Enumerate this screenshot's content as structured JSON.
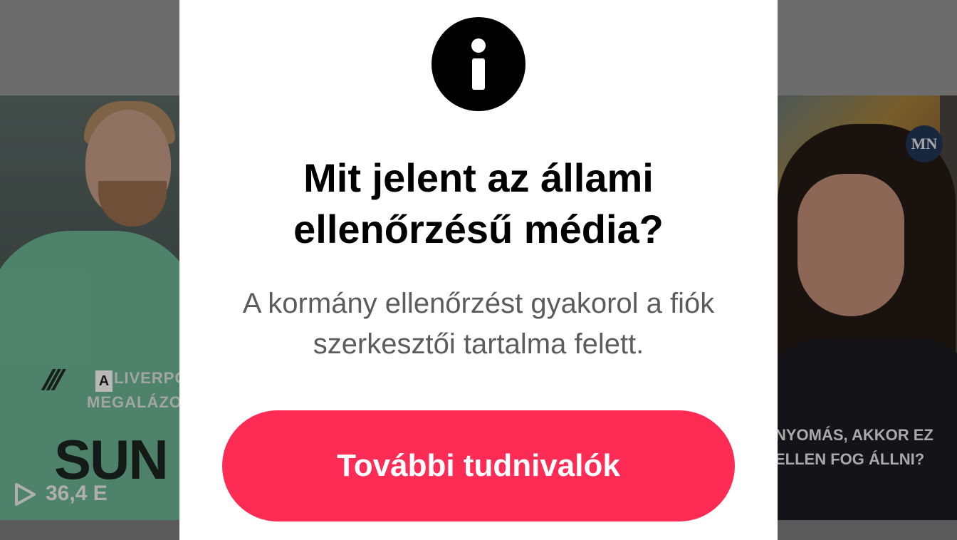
{
  "left_video": {
    "caption_line1": "LIVERPOO",
    "caption_line2": "MEGALÁZOTT",
    "badge_letter": "A",
    "sponsor_text": "SUN",
    "view_count": "36,4 E"
  },
  "right_video": {
    "logo_text": "MN",
    "caption_line1": "NYOMÁS, AKKOR EZ",
    "caption_line2": "ELLEN FOG ÁLLNI?"
  },
  "modal": {
    "icon": "info-icon",
    "title": "Mit jelent az állami ellenőrzésű média?",
    "description": "A kormány ellenőrzést gyakorol a fiók szerkesztői tartalma felett.",
    "button_label": "További tudnivalók",
    "accent_color": "#fe2c55"
  }
}
